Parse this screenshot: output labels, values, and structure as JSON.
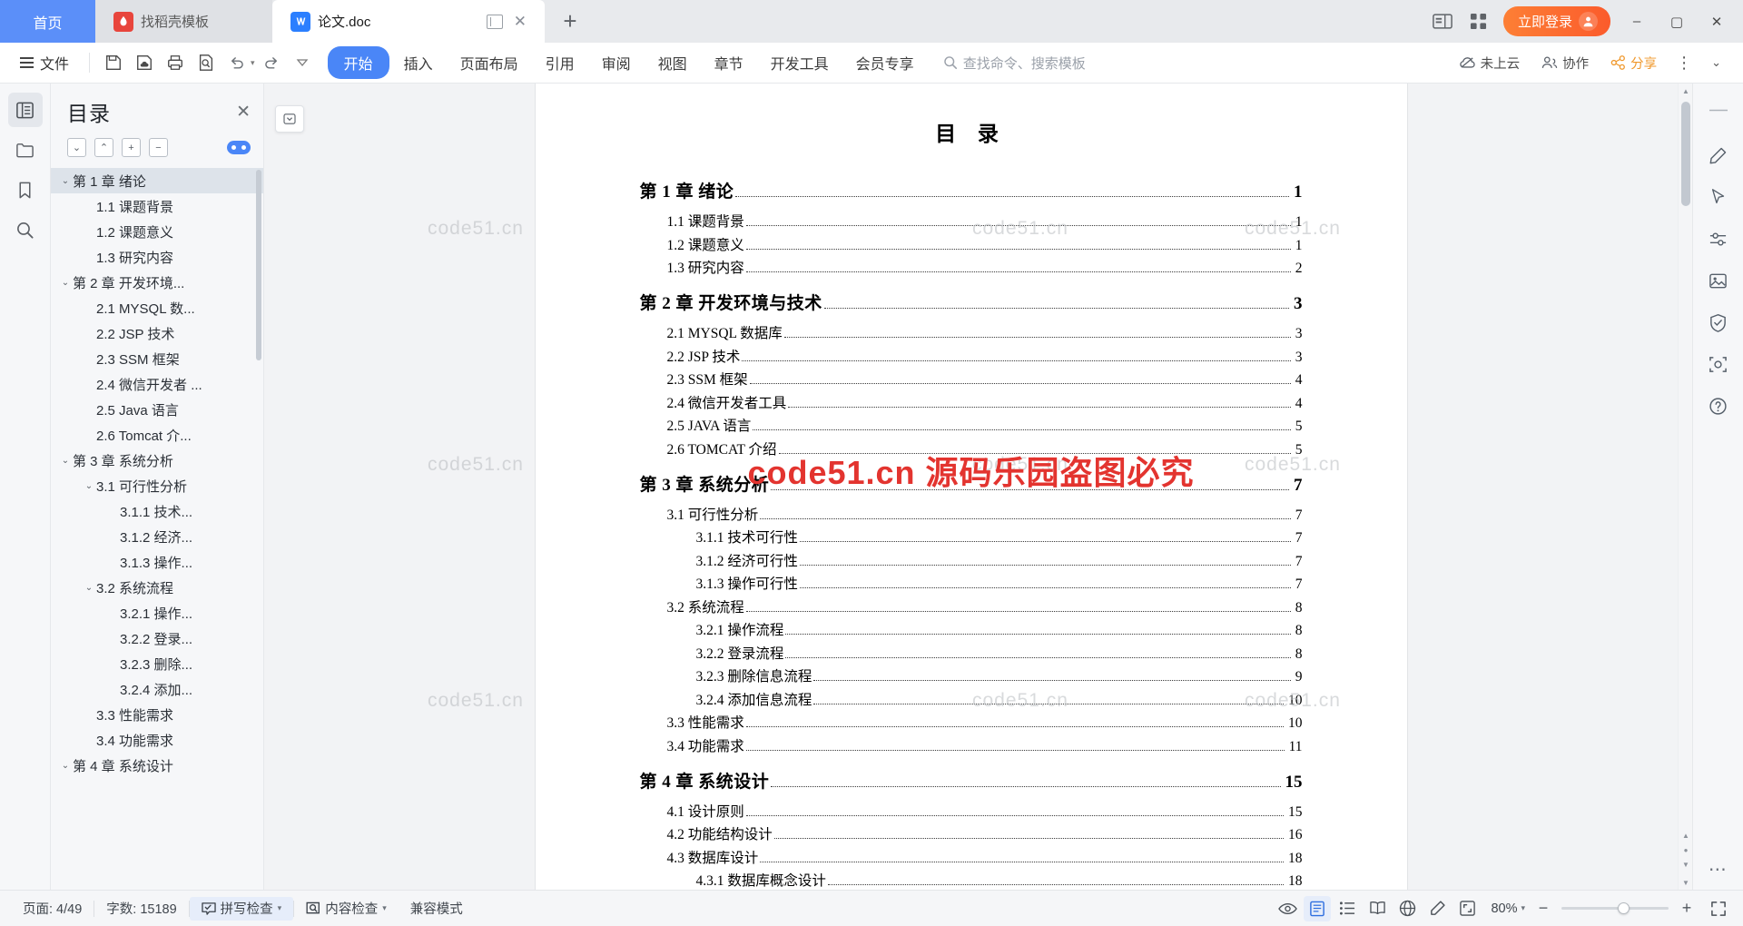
{
  "window": {
    "tabs": [
      {
        "label": "首页",
        "icon": "home-tab",
        "type": "home"
      },
      {
        "label": "找稻壳模板",
        "icon": "docer-icon",
        "type": "inactive"
      },
      {
        "label": "论文.doc",
        "icon": "writer-doc-icon",
        "type": "active"
      }
    ],
    "new_tab": "+",
    "controls": {
      "split_view": "split-view-icon",
      "grid_view": "grid-view-icon",
      "login_label": "立即登录",
      "minimize": "–",
      "maximize": "▢",
      "close": "✕"
    }
  },
  "ribbon": {
    "file_label": "文件",
    "quick_icons": [
      "save-icon",
      "save-cloud-icon",
      "print-icon",
      "print-preview-icon",
      "undo-icon",
      "redo-icon",
      "customize-icon"
    ],
    "menus": [
      {
        "label": "开始",
        "active": true
      },
      {
        "label": "插入",
        "active": false
      },
      {
        "label": "页面布局",
        "active": false
      },
      {
        "label": "引用",
        "active": false
      },
      {
        "label": "审阅",
        "active": false
      },
      {
        "label": "视图",
        "active": false
      },
      {
        "label": "章节",
        "active": false
      },
      {
        "label": "开发工具",
        "active": false
      },
      {
        "label": "会员专享",
        "active": false
      }
    ],
    "search_placeholder": "查找命令、搜索模板",
    "right": [
      {
        "label": "未上云",
        "icon": "cloud-icon"
      },
      {
        "label": "协作",
        "icon": "collaborate-icon"
      },
      {
        "label": "分享",
        "icon": "share-icon"
      }
    ],
    "more": "⋮",
    "collapse": "⌄"
  },
  "left_rail": [
    {
      "icon": "toc-panel-icon",
      "selected": true
    },
    {
      "icon": "folder-icon",
      "selected": false
    },
    {
      "icon": "bookmark-icon",
      "selected": false
    },
    {
      "icon": "search-icon",
      "selected": false
    }
  ],
  "toc_panel": {
    "title": "目录",
    "close": "✕",
    "tools": [
      "collapse-down-icon",
      "collapse-up-icon",
      "expand-all-icon",
      "collapse-all-icon"
    ],
    "toggle": "level-toggle-pill",
    "items": [
      {
        "label": "第 1 章 绪论",
        "indent": 0,
        "chevron": "⌄",
        "selected": true
      },
      {
        "label": "1.1 课题背景",
        "indent": 1,
        "chevron": ""
      },
      {
        "label": "1.2 课题意义",
        "indent": 1,
        "chevron": ""
      },
      {
        "label": "1.3 研究内容",
        "indent": 1,
        "chevron": ""
      },
      {
        "label": "第 2 章 开发环境...",
        "indent": 0,
        "chevron": "⌄"
      },
      {
        "label": "2.1 MYSQL 数...",
        "indent": 1,
        "chevron": ""
      },
      {
        "label": "2.2 JSP 技术",
        "indent": 1,
        "chevron": ""
      },
      {
        "label": "2.3 SSM 框架",
        "indent": 1,
        "chevron": ""
      },
      {
        "label": "2.4 微信开发者 ...",
        "indent": 1,
        "chevron": ""
      },
      {
        "label": "2.5 Java 语言",
        "indent": 1,
        "chevron": ""
      },
      {
        "label": "2.6 Tomcat 介...",
        "indent": 1,
        "chevron": ""
      },
      {
        "label": "第 3 章 系统分析",
        "indent": 0,
        "chevron": "⌄"
      },
      {
        "label": "3.1 可行性分析",
        "indent": 1,
        "chevron": "⌄"
      },
      {
        "label": "3.1.1 技术...",
        "indent": 2,
        "chevron": ""
      },
      {
        "label": "3.1.2 经济...",
        "indent": 2,
        "chevron": ""
      },
      {
        "label": "3.1.3 操作...",
        "indent": 2,
        "chevron": ""
      },
      {
        "label": "3.2 系统流程",
        "indent": 1,
        "chevron": "⌄"
      },
      {
        "label": "3.2.1 操作...",
        "indent": 2,
        "chevron": ""
      },
      {
        "label": "3.2.2 登录...",
        "indent": 2,
        "chevron": ""
      },
      {
        "label": "3.2.3 删除...",
        "indent": 2,
        "chevron": ""
      },
      {
        "label": "3.2.4 添加...",
        "indent": 2,
        "chevron": ""
      },
      {
        "label": "3.3 性能需求",
        "indent": 1,
        "chevron": ""
      },
      {
        "label": "3.4 功能需求",
        "indent": 1,
        "chevron": ""
      },
      {
        "label": "第 4 章 系统设计",
        "indent": 0,
        "chevron": "⌄"
      }
    ]
  },
  "document": {
    "title": "目  录",
    "entries": [
      {
        "text": "第 1 章 绪论",
        "page": "1",
        "level": 1
      },
      {
        "text": "1.1 课题背景",
        "page": "1",
        "level": 2
      },
      {
        "text": "1.2 课题意义",
        "page": "1",
        "level": 2
      },
      {
        "text": "1.3 研究内容",
        "page": "2",
        "level": 2
      },
      {
        "text": "第 2 章 开发环境与技术",
        "page": "3",
        "level": 1
      },
      {
        "text": "2.1 MYSQL 数据库",
        "page": "3",
        "level": 2
      },
      {
        "text": "2.2 JSP 技术",
        "page": "3",
        "level": 2
      },
      {
        "text": "2.3 SSM 框架",
        "page": "4",
        "level": 2
      },
      {
        "text": "2.4 微信开发者工具",
        "page": "4",
        "level": 2
      },
      {
        "text": "2.5 JAVA 语言",
        "page": "5",
        "level": 2
      },
      {
        "text": "2.6 TOMCAT 介绍",
        "page": "5",
        "level": 2
      },
      {
        "text": "第 3 章 系统分析",
        "page": "7",
        "level": 1
      },
      {
        "text": "3.1 可行性分析",
        "page": "7",
        "level": 2
      },
      {
        "text": "3.1.1 技术可行性",
        "page": "7",
        "level": 3
      },
      {
        "text": "3.1.2 经济可行性",
        "page": "7",
        "level": 3
      },
      {
        "text": "3.1.3 操作可行性",
        "page": "7",
        "level": 3
      },
      {
        "text": "3.2 系统流程",
        "page": "8",
        "level": 2
      },
      {
        "text": "3.2.1 操作流程",
        "page": "8",
        "level": 3
      },
      {
        "text": "3.2.2 登录流程",
        "page": "8",
        "level": 3
      },
      {
        "text": "3.2.3 删除信息流程",
        "page": "9",
        "level": 3
      },
      {
        "text": "3.2.4 添加信息流程",
        "page": "10",
        "level": 3
      },
      {
        "text": "3.3 性能需求",
        "page": "10",
        "level": 2
      },
      {
        "text": "3.4 功能需求",
        "page": "11",
        "level": 2
      },
      {
        "text": "第 4 章 系统设计",
        "page": "15",
        "level": 1
      },
      {
        "text": "4.1 设计原则",
        "page": "15",
        "level": 2
      },
      {
        "text": "4.2 功能结构设计",
        "page": "16",
        "level": 2
      },
      {
        "text": "4.3 数据库设计",
        "page": "18",
        "level": 2
      },
      {
        "text": "4.3.1 数据库概念设计",
        "page": "18",
        "level": 3
      }
    ],
    "watermarks": [
      "code51.cn",
      "code51.cn",
      "code51.cn",
      "code51.cn",
      "code51.cn",
      "code51.cn",
      "code51.cn",
      "code51.cn"
    ],
    "red_watermark": "code51.cn 源码乐园盗图必究"
  },
  "right_rail": [
    {
      "icon": "pen-edit-icon"
    },
    {
      "icon": "cursor-select-icon"
    },
    {
      "icon": "annotate-icon"
    },
    {
      "icon": "picture-tool-icon"
    },
    {
      "icon": "shield-icon"
    },
    {
      "icon": "screenshot-icon"
    },
    {
      "icon": "help-icon"
    }
  ],
  "right_rail_more": "⋯",
  "status_bar": {
    "page": "页面: 4/49",
    "word_count": "字数: 15189",
    "spell_check": "拼写检查",
    "content_check": "内容检查",
    "compat_mode": "兼容模式",
    "view_icons": [
      "eye-preview-icon",
      "page-view-icon",
      "outline-view-icon",
      "reading-view-icon",
      "web-view-icon",
      "ink-icon",
      "fit-page-icon"
    ],
    "zoom_level": "80%",
    "zoom_out": "−",
    "zoom_in": "+",
    "fullscreen": "fullscreen-icon"
  }
}
